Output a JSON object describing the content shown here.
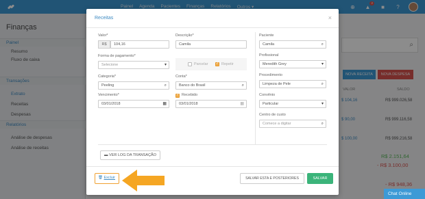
{
  "topbar": {
    "nav": [
      "Painel",
      "Agenda",
      "Pacientes",
      "Finanças",
      "Relatórios",
      "Outros ▾"
    ],
    "notification_count": "2",
    "icons": [
      "logo-icon",
      "plus-circle-icon",
      "bell-icon",
      "flag-icon",
      "help-icon",
      "avatar"
    ]
  },
  "sidebar": {
    "title": "Finanças",
    "sections": [
      {
        "label": "Painel",
        "items": [
          "Resumo",
          "Fluxo de caixa"
        ]
      },
      {
        "label": "Transações",
        "items": [
          "Extrato",
          "Receitas",
          "Despesas"
        ]
      },
      {
        "label": "Relatórios",
        "items": [
          "Análise de despesas",
          "Análise de receitas"
        ]
      }
    ],
    "active_item": "Extrato"
  },
  "background": {
    "btn_nova_receita": "NOVA RECEITA",
    "btn_nova_despesa": "NOVA DESPESA",
    "col_valor": "VALOR",
    "col_saldo": "SALDO",
    "rows": [
      {
        "valor": "$ 104,16",
        "saldo": "R$ 999.026,58"
      },
      {
        "valor": "$ 90,00",
        "saldo": "R$ 999.116,58"
      },
      {
        "valor": "$ 100,00",
        "saldo": "R$ 999.216,58"
      }
    ],
    "total_pos": "R$ 2.151,64",
    "total_neg": "- R$ 3.100,00",
    "total_neg2": "- R$ 948,36",
    "chat_label": "Chat Online"
  },
  "modal": {
    "title": "Receitas",
    "close": "×",
    "valor": {
      "label": "Valor*",
      "prefix": "R$",
      "value": "104,16"
    },
    "descricao": {
      "label": "Descrição*",
      "value": "Camila"
    },
    "forma_pagamento": {
      "label": "Forma de pagamento*",
      "placeholder": "Selecione"
    },
    "parcelar_label": "Parcelar",
    "repetir_label": "Repetir",
    "categoria": {
      "label": "Categoria*",
      "value": "Peeling"
    },
    "conta": {
      "label": "Conta*",
      "value": "Banco do Brasil"
    },
    "vencimento": {
      "label": "Vencimento*",
      "value": "03/01/2018"
    },
    "recebido": {
      "label": "Recebido",
      "value": "03/01/2018"
    },
    "paciente": {
      "label": "Paciente",
      "value": "Camila"
    },
    "profissional": {
      "label": "Profissional",
      "value": "Meredith Grey"
    },
    "procedimento": {
      "label": "Procedimento",
      "value": "Limpeza de Pele"
    },
    "convenio": {
      "label": "Convênio",
      "value": "Particular"
    },
    "centro_custo": {
      "label": "Centro de custo",
      "placeholder": "Comece a digitar"
    },
    "log_button": "VER LOG DA TRANSAÇÃO",
    "excluir": "Excluir",
    "save_following": "SALVAR ESTA E POSTERIORES",
    "save": "SALVAR"
  },
  "colors": {
    "topbar": "#3d9ad6",
    "accent": "#3d8ac2",
    "save_green": "#3bb47a",
    "highlight_orange": "#f0a030",
    "nova_receita": "#3d9ad6",
    "nova_despesa": "#d9534f"
  }
}
